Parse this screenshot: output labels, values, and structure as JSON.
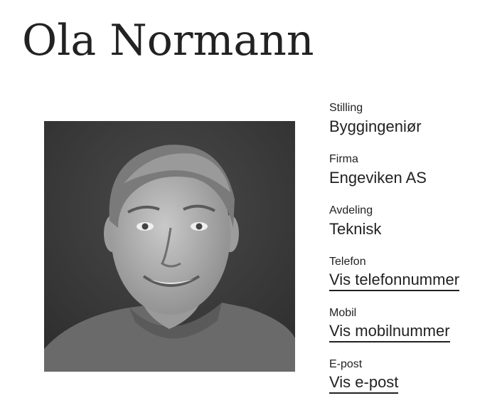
{
  "person": {
    "name": "Ola Normann",
    "photo_alt": "Portrett av Ola Normann"
  },
  "fields": [
    {
      "label": "Stilling",
      "value": "Byggingeniør"
    },
    {
      "label": "Firma",
      "value": "Engeviken AS"
    },
    {
      "label": "Avdeling",
      "value": "Teknisk"
    },
    {
      "label": "Telefon",
      "link": "Vis telefonnummer"
    },
    {
      "label": "Mobil",
      "link": "Vis mobilnummer"
    },
    {
      "label": "E-post",
      "link": "Vis e-post"
    }
  ],
  "colors": {
    "text": "#222222",
    "background": "#ffffff",
    "photo_background": "#3a3a3a"
  }
}
